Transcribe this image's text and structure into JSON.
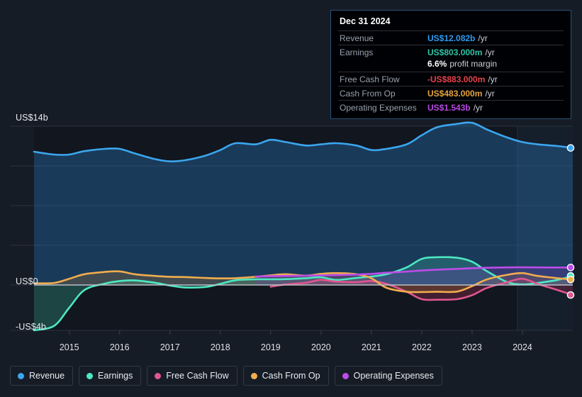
{
  "background": "#161c26",
  "tooltip": {
    "date": "Dec 31 2024",
    "rows": [
      {
        "label": "Revenue",
        "value": "US$12.082b",
        "unit": "/yr",
        "color": "#2d9bf0"
      },
      {
        "label": "Earnings",
        "value": "US$803.000m",
        "unit": "/yr",
        "color": "#2ec4a6"
      },
      {
        "label": "",
        "value": "6.6%",
        "unit": "profit margin",
        "color": "#ffffff"
      },
      {
        "label": "Free Cash Flow",
        "value": "-US$883.000m",
        "unit": "/yr",
        "color": "#e8414a"
      },
      {
        "label": "Cash From Op",
        "value": "US$483.000m",
        "unit": "/yr",
        "color": "#e8a33d"
      },
      {
        "label": "Operating Expenses",
        "value": "US$1.543b",
        "unit": "/yr",
        "color": "#b44ae0"
      }
    ]
  },
  "legend": [
    {
      "label": "Revenue",
      "color": "#3ba6ee"
    },
    {
      "label": "Earnings",
      "color": "#4de8c2"
    },
    {
      "label": "Free Cash Flow",
      "color": "#e0568f"
    },
    {
      "label": "Cash From Op",
      "color": "#f0ad4e"
    },
    {
      "label": "Operating Expenses",
      "color": "#bd4ce8"
    }
  ],
  "chart_data": {
    "type": "area",
    "title": "",
    "xlabel": "",
    "ylabel": "",
    "grid": true,
    "legend_position": "bottom",
    "ylim": [
      -4,
      14
    ],
    "y_ticks": [
      {
        "value": 14,
        "label": "US$14b"
      },
      {
        "value": 0,
        "label": "US$0"
      },
      {
        "value": -4,
        "label": "-US$4b"
      }
    ],
    "gridline_values": [
      14,
      10.5,
      7,
      3.5,
      0,
      -4
    ],
    "x_ticks": [
      "2015",
      "2016",
      "2017",
      "2018",
      "2019",
      "2020",
      "2021",
      "2022",
      "2023",
      "2024"
    ],
    "xlim": [
      2014.3,
      2025.0
    ],
    "forecast_start": "2023.9",
    "units": "US$ billions",
    "series": [
      {
        "name": "Revenue",
        "color": "#3ba6ee",
        "fill": "rgba(40,110,170,0.42)",
        "x": [
          2014.3,
          2014.7,
          2015.0,
          2015.3,
          2015.7,
          2016.0,
          2016.3,
          2016.7,
          2017.0,
          2017.3,
          2017.7,
          2018.0,
          2018.3,
          2018.7,
          2019.0,
          2019.3,
          2019.7,
          2020.0,
          2020.3,
          2020.7,
          2021.0,
          2021.3,
          2021.7,
          2022.0,
          2022.3,
          2022.7,
          2023.0,
          2023.3,
          2023.7,
          2024.0,
          2024.3,
          2024.7,
          2025.0
        ],
        "values": [
          11.75,
          11.5,
          11.5,
          11.8,
          12.0,
          12.0,
          11.6,
          11.1,
          10.9,
          11.0,
          11.4,
          11.9,
          12.5,
          12.4,
          12.8,
          12.6,
          12.3,
          12.4,
          12.5,
          12.3,
          11.9,
          12.0,
          12.4,
          13.2,
          13.9,
          14.2,
          14.3,
          13.7,
          13.0,
          12.6,
          12.4,
          12.25,
          12.082
        ]
      },
      {
        "name": "Earnings",
        "color": "#4de8c2",
        "fill": "rgba(60,180,155,0.30)",
        "x": [
          2014.3,
          2014.7,
          2015.0,
          2015.3,
          2015.7,
          2016.0,
          2016.3,
          2016.7,
          2017.0,
          2017.3,
          2017.7,
          2018.0,
          2018.3,
          2018.7,
          2019.0,
          2019.3,
          2019.7,
          2020.0,
          2020.3,
          2020.7,
          2021.0,
          2021.3,
          2021.7,
          2022.0,
          2022.3,
          2022.7,
          2023.0,
          2023.3,
          2023.7,
          2024.0,
          2024.3,
          2024.7,
          2025.0
        ],
        "values": [
          -4.0,
          -3.6,
          -2.0,
          -0.45,
          0.12,
          0.35,
          0.4,
          0.2,
          -0.05,
          -0.22,
          -0.18,
          0.1,
          0.42,
          0.5,
          0.5,
          0.52,
          0.6,
          0.68,
          0.45,
          0.62,
          0.75,
          0.95,
          1.55,
          2.3,
          2.45,
          2.4,
          2.05,
          1.2,
          0.25,
          0.05,
          0.18,
          0.45,
          0.803
        ]
      },
      {
        "name": "Free Cash Flow",
        "color": "#e0568f",
        "fill": "rgba(180,50,90,0.30)",
        "x": [
          2019.0,
          2019.3,
          2019.7,
          2020.0,
          2020.3,
          2020.7,
          2021.0,
          2021.3,
          2021.7,
          2022.0,
          2022.3,
          2022.7,
          2023.0,
          2023.3,
          2023.7,
          2024.0,
          2024.3,
          2024.7,
          2025.0
        ],
        "values": [
          -0.15,
          0.05,
          0.2,
          0.45,
          0.3,
          0.25,
          0.35,
          0.1,
          -0.6,
          -1.25,
          -1.3,
          -1.25,
          -0.9,
          -0.25,
          0.25,
          0.55,
          0.1,
          -0.45,
          -0.883
        ]
      },
      {
        "name": "Cash From Op",
        "color": "#f0ad4e",
        "fill": "rgba(170,120,50,0.28)",
        "x": [
          2014.3,
          2014.7,
          2015.0,
          2015.3,
          2015.7,
          2016.0,
          2016.3,
          2016.7,
          2017.0,
          2017.3,
          2017.7,
          2018.0,
          2018.3,
          2018.7,
          2019.0,
          2019.3,
          2019.7,
          2020.0,
          2020.3,
          2020.7,
          2021.0,
          2021.3,
          2021.7,
          2022.0,
          2022.3,
          2022.7,
          2023.0,
          2023.3,
          2023.7,
          2024.0,
          2024.3,
          2024.7,
          2025.0
        ],
        "values": [
          0.15,
          0.18,
          0.55,
          0.95,
          1.15,
          1.2,
          0.95,
          0.8,
          0.72,
          0.7,
          0.62,
          0.58,
          0.6,
          0.72,
          0.85,
          0.95,
          0.82,
          0.98,
          1.05,
          0.95,
          0.6,
          -0.25,
          -0.6,
          -0.62,
          -0.6,
          -0.58,
          -0.1,
          0.5,
          0.9,
          1.05,
          0.8,
          0.6,
          0.483
        ]
      },
      {
        "name": "Operating Expenses",
        "color": "#bd4ce8",
        "fill": "rgba(120,60,180,0.28)",
        "x": [
          2018.7,
          2019.0,
          2019.3,
          2019.7,
          2020.0,
          2020.3,
          2020.7,
          2021.0,
          2021.3,
          2021.7,
          2022.0,
          2022.3,
          2022.7,
          2023.0,
          2023.3,
          2023.7,
          2024.0,
          2024.3,
          2024.7,
          2025.0
        ],
        "values": [
          0.75,
          0.78,
          0.8,
          0.82,
          0.85,
          0.88,
          0.92,
          0.98,
          1.08,
          1.18,
          1.28,
          1.35,
          1.42,
          1.48,
          1.52,
          1.55,
          1.56,
          1.55,
          1.54,
          1.543
        ]
      }
    ],
    "end_markers": [
      {
        "name": "Revenue",
        "value": 12.082,
        "color": "#3ba6ee"
      },
      {
        "name": "Operating Expenses",
        "value": 1.543,
        "color": "#bd4ce8"
      },
      {
        "name": "Earnings",
        "value": 0.803,
        "color": "#4de8c2"
      },
      {
        "name": "Cash From Op",
        "value": 0.483,
        "color": "#f0ad4e"
      },
      {
        "name": "Free Cash Flow",
        "value": -0.883,
        "color": "#e0568f"
      }
    ]
  }
}
